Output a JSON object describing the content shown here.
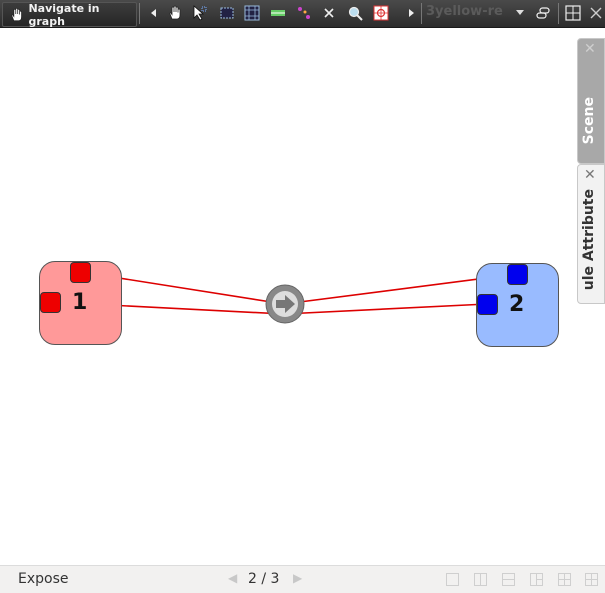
{
  "toolbar": {
    "mode_label": "Navigate in graph",
    "combo_value": "3yellow-re",
    "icons": [
      "hand-icon",
      "select-arrow-icon",
      "box-select-icon",
      "grid-select-icon",
      "fit-icon",
      "dots-icon",
      "delete-icon",
      "zoom-icon",
      "center-icon"
    ]
  },
  "graph": {
    "nodes": [
      {
        "label": "1",
        "color": "#ff9999",
        "port_color": "#ee0000"
      },
      {
        "label": "2",
        "color": "#99bbff",
        "port_color": "#0000ee"
      }
    ],
    "edge_color": "#dd0000"
  },
  "side_panels": [
    {
      "label": "Scene"
    },
    {
      "label": "ule Attribute"
    }
  ],
  "status": {
    "mode": "Expose",
    "pager": "2 / 3"
  }
}
